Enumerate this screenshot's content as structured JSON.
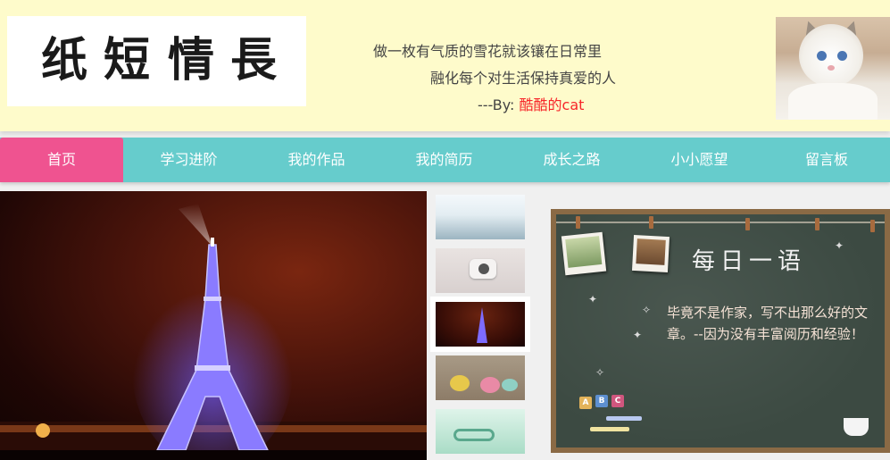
{
  "header": {
    "logo_chars": [
      "纸",
      "短",
      "情",
      "長"
    ],
    "motto_line1": "做一枚有气质的雪花就该镶在日常里",
    "motto_line2": "融化每个对生活保持真爱的人",
    "byline_prefix": "---By: ",
    "byline_author": "酷酷的cat"
  },
  "nav": {
    "items": [
      {
        "label": "首页",
        "active": true
      },
      {
        "label": "学习进阶"
      },
      {
        "label": "我的作品"
      },
      {
        "label": "我的简历"
      },
      {
        "label": "成长之路"
      },
      {
        "label": "小小愿望"
      },
      {
        "label": "留言板"
      }
    ]
  },
  "carousel": {
    "active_index": 3,
    "thumb_count": 5
  },
  "quote_board": {
    "title": "每日一语",
    "text": "毕竟不是作家，写不出那么好的文章。--因为没有丰富阅历和经验！",
    "blocks": [
      "A",
      "B",
      "C"
    ]
  },
  "colors": {
    "header_bg": "#fefbcb",
    "nav_bg": "#66cccc",
    "nav_active": "#ef5390",
    "author_red": "#f7262a",
    "board_frame": "#8a6a45",
    "board_bg": "#3c4a42"
  }
}
